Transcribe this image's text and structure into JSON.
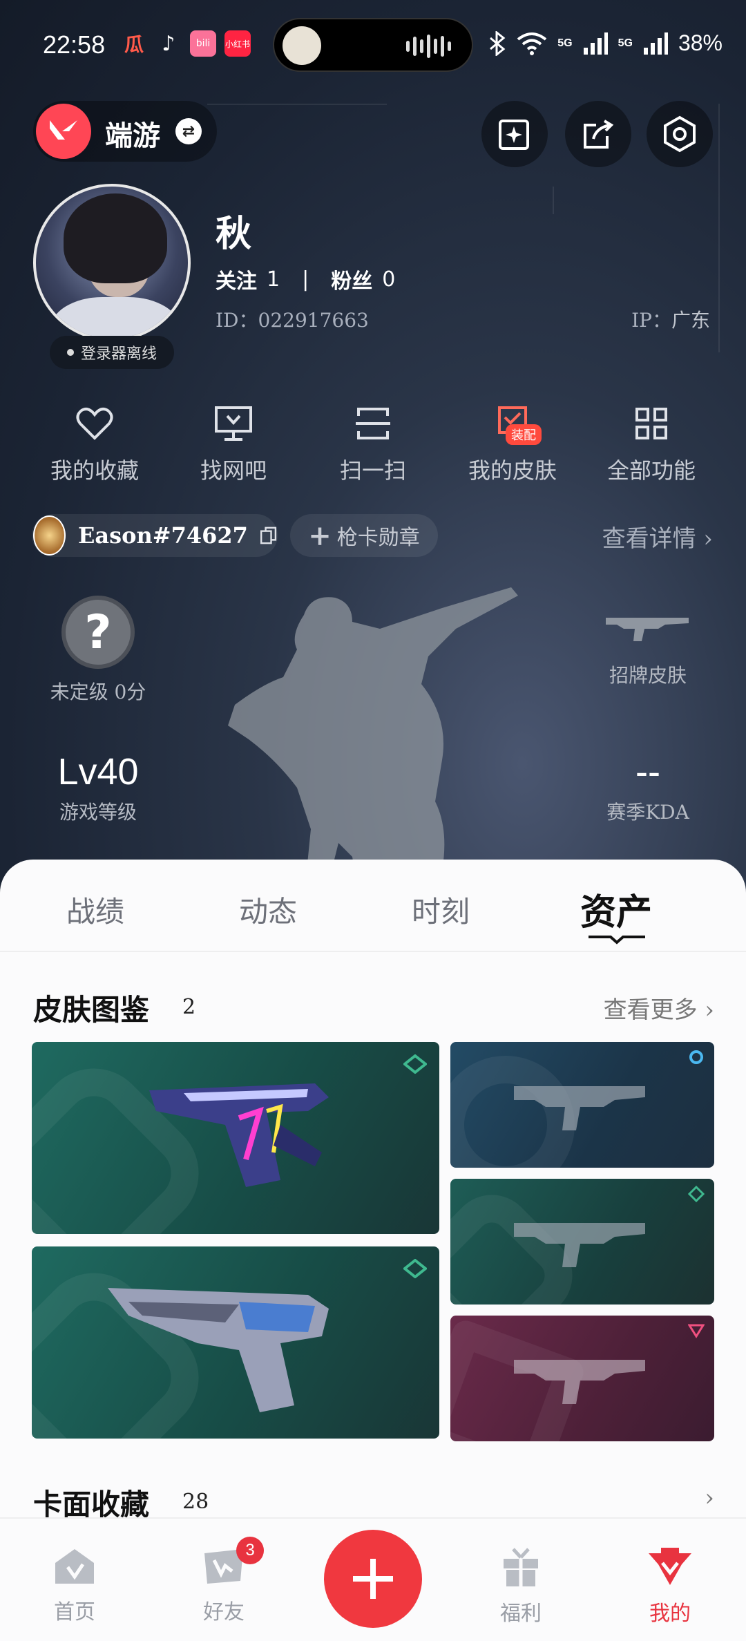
{
  "status_bar": {
    "time": "22:58",
    "apps": [
      "瓜",
      "♪",
      "bili",
      "小红书"
    ],
    "network_1": "5G",
    "network_2": "5G",
    "battery": "38%"
  },
  "header": {
    "game_name": "端游",
    "switch_icon": "swap-icon"
  },
  "profile": {
    "nickname": "秋",
    "follow_label": "关注",
    "follow_count": "1",
    "fans_label": "粉丝",
    "fans_count": "0",
    "id_label": "ID：",
    "id_value": "022917663",
    "ip_label": "IP：",
    "ip_value": "广东",
    "status": "登录器离线"
  },
  "actions": [
    {
      "label": "我的收藏",
      "icon": "heart-icon"
    },
    {
      "label": "找网吧",
      "icon": "monitor-icon"
    },
    {
      "label": "扫一扫",
      "icon": "scan-icon"
    },
    {
      "label": "我的皮肤",
      "icon": "skin-icon",
      "badge": "装配"
    },
    {
      "label": "全部功能",
      "icon": "grid-icon"
    }
  ],
  "riot": {
    "name": "Eason#74627",
    "card_badge": "枪卡勋章",
    "see_detail": "查看详情"
  },
  "stats": {
    "rank_label": "未定级 0分",
    "rank_symbol": "?",
    "skin_label": "招牌皮肤",
    "level_value": "Lv40",
    "level_label": "游戏等级",
    "kda_value": "--",
    "kda_label": "赛季KDA"
  },
  "tabs": [
    "战绩",
    "动态",
    "时刻",
    "资产"
  ],
  "active_tab": "资产",
  "skins_section": {
    "title": "皮肤图鉴",
    "count": "2",
    "more": "查看更多"
  },
  "cards_section": {
    "title": "卡面收藏",
    "count": "28"
  },
  "bottom_nav": [
    {
      "label": "首页",
      "icon": "home-icon"
    },
    {
      "label": "好友",
      "icon": "friends-icon",
      "badge": "3"
    },
    {
      "label": "福利",
      "icon": "gift-icon"
    },
    {
      "label": "我的",
      "icon": "profile-icon"
    }
  ],
  "colors": {
    "accent": "#ff4655",
    "nav_active": "#e8333f",
    "fab": "#f0383f"
  }
}
